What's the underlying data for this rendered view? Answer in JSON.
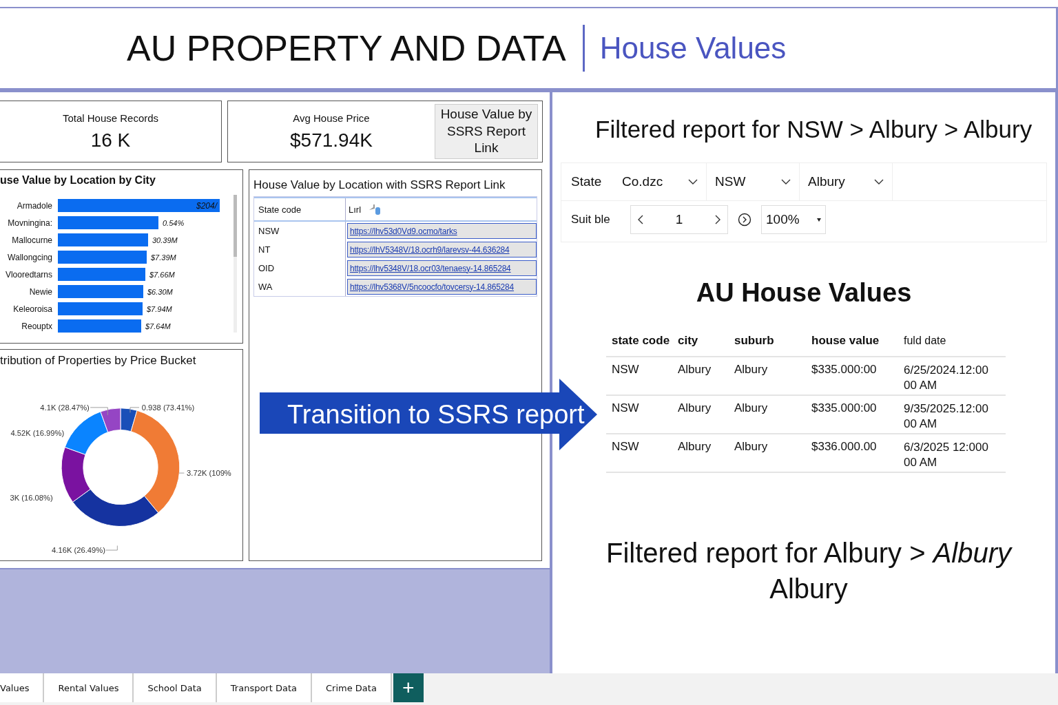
{
  "header": {
    "title": "AU PROPERTY AND DATA",
    "subtitle": "House Values"
  },
  "kpis": [
    {
      "label": "Total House Records",
      "value": "16 K"
    },
    {
      "label": "Avg House Price",
      "value": "$571.94K"
    }
  ],
  "report_link_button": "House Value by SSRS Report Link",
  "bar_panel": {
    "title": "use Value by Location by City",
    "bars": [
      {
        "city": "Armadole",
        "value_label": "$204/"
      },
      {
        "city": "Movningina:",
        "value_label": "0.54%"
      },
      {
        "city": "Mallocurne",
        "value_label": "30.39M"
      },
      {
        "city": "Wallongcing",
        "value_label": "$7.39M"
      },
      {
        "city": "Vlooredtarns",
        "value_label": "$7.66M"
      },
      {
        "city": "Newie",
        "value_label": "$6.30M"
      },
      {
        "city": "Keleoroisa",
        "value_label": "$7.94M"
      },
      {
        "city": "Reouptx",
        "value_label": "$7.64M"
      }
    ]
  },
  "link_table": {
    "title": "House Value by Location with SSRS Report Link",
    "columns": [
      "State code",
      "Lırl"
    ],
    "rows": [
      {
        "state": "NSW",
        "url": "https://lhv53d0Vd9.ocmo/tarks"
      },
      {
        "state": "NT",
        "url": "https://lhV5348V/18.ocrh9/larevsv-44.636284"
      },
      {
        "state": "OID",
        "url": "https://lhv5348V/18.ocr03/tenaesy-14.865284"
      },
      {
        "state": "WA",
        "url": "https://lhv5368V/5ncoocfo/tovcersy-14.865284"
      }
    ]
  },
  "donut_panel": {
    "title": "tribution of Properties by Price Bucket",
    "slices": [
      {
        "label": "0.938 (73.41%)",
        "color": "#1a4fb8"
      },
      {
        "label": "3.72K (109%",
        "color": "#f07b35"
      },
      {
        "label": "4.16K (26.49%)",
        "color": "#1533a0"
      },
      {
        "label": "3K (16.08%)",
        "color": "#7a12a0"
      },
      {
        "label": "4.52K (16.99%)",
        "color": "#0a84ff"
      },
      {
        "label": "4.1K (28.47%)",
        "color": "#9545c4"
      }
    ]
  },
  "banner": "Transition to SSRS report",
  "report": {
    "heading": "Filtered report for NSW > Albury > Albury",
    "filters": {
      "label": "State",
      "values": [
        "Co.dzc",
        "NSW",
        "Albury"
      ]
    },
    "pager": {
      "label": "Suit ble",
      "page": "1",
      "zoom": "100%"
    },
    "title": "AU House Values",
    "columns": [
      "state code",
      "city",
      "suburb",
      "house value",
      "fuld date"
    ],
    "rows": [
      [
        "NSW",
        "Albury",
        "Albury",
        "$335.000:00",
        "6/25/2024.12:00 00 AM"
      ],
      [
        "NSW",
        "Albury",
        "Albury",
        "$335.000:00",
        "9/35/2025.12:00 00 AM"
      ],
      [
        "NSW",
        "Albury",
        "Albury",
        "$336.000.00",
        "6/3/2025 12:000 00 AM"
      ]
    ],
    "footer": "Filtered report for Albury > *Albury* Albury"
  },
  "tabs": [
    "Values",
    "Rental Values",
    "School Data",
    "Transport Data",
    "Crime Data"
  ],
  "add_tab": "+"
}
